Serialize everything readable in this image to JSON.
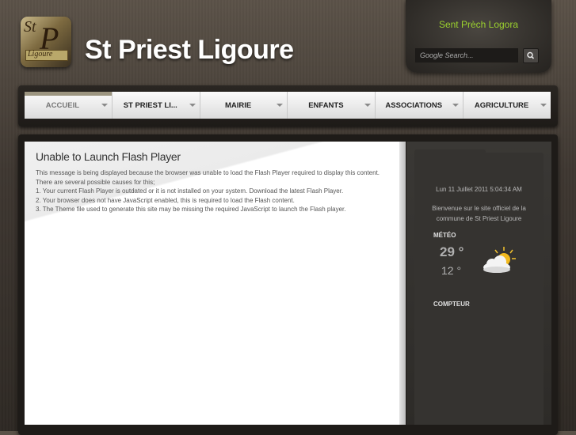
{
  "header": {
    "site_title": "St Priest Ligoure",
    "logo_text": {
      "st": "St",
      "p": "P",
      "band": "Ligoure"
    },
    "slogan": "Sent Prèch Logora",
    "search_placeholder": "Google Search..."
  },
  "nav": {
    "items": [
      {
        "label": "ACCUEIL"
      },
      {
        "label": "ST PRIEST LI..."
      },
      {
        "label": "MAIRIE"
      },
      {
        "label": "ENFANTS"
      },
      {
        "label": "ASSOCIATIONS"
      },
      {
        "label": "AGRICULTURE"
      }
    ]
  },
  "main": {
    "flash_title": "Unable to Launch Flash Player",
    "lines": [
      "This message is being displayed because the browser was unable to load the Flash Player required to display this content.",
      "There are several possible causes for this;",
      "1.  Your current Flash Player is outdated or it is not installed on your system. Download the latest Flash Player.",
      "2.  Your browser does not have JavaScript enabled, this is required to load the Flash content.",
      "3.  The Theme file used to generate this site may be missing the required JavaScript to launch the Flash player."
    ]
  },
  "sidebar": {
    "datetime": "Lun 11 Juillet 2011 5:04:34 AM",
    "welcome": "Bienvenue sur le site officiel de la commune de St Priest Ligoure",
    "meteo_heading": "MÉTÉO",
    "temp_high": "29 °",
    "temp_low": "12 °",
    "weather_icon": "partly-cloudy-icon",
    "compteur_heading": "COMPTEUR"
  },
  "colors": {
    "slogan": "#9bd12e",
    "background": "#3e3731"
  }
}
